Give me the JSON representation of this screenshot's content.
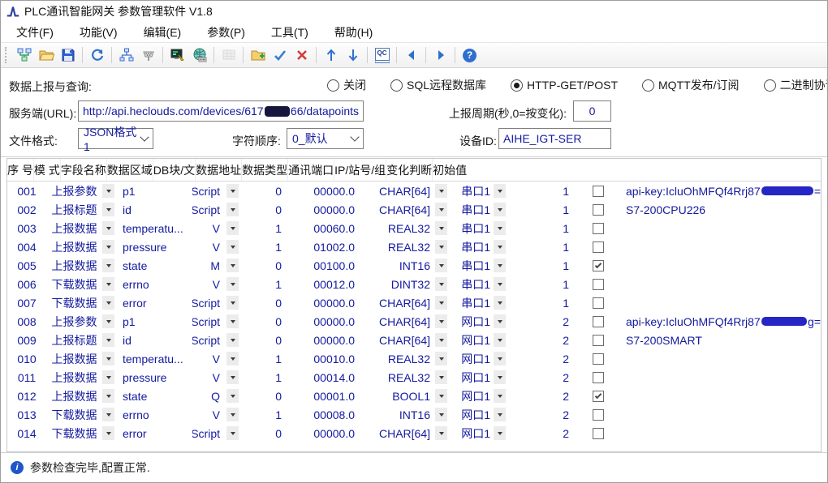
{
  "window": {
    "title": "PLC通讯智能网关 参数管理软件 V1.8"
  },
  "menubar": {
    "items": [
      {
        "name": "menu-file",
        "label": "文件(F)"
      },
      {
        "name": "menu-function",
        "label": "功能(V)"
      },
      {
        "name": "menu-edit",
        "label": "编辑(E)"
      },
      {
        "name": "menu-params",
        "label": "参数(P)"
      },
      {
        "name": "menu-tools",
        "label": "工具(T)"
      },
      {
        "name": "menu-help",
        "label": "帮助(H)"
      }
    ]
  },
  "toolbar": {
    "qc_label": "QC"
  },
  "icons": {
    "help_glyph": "?",
    "info_glyph": "i"
  },
  "colors": {
    "navy": "#131a9e"
  },
  "config": {
    "report_label": "数据上报与查询:",
    "report_options": [
      {
        "name": "radio-close",
        "label": "关闭",
        "selected": false
      },
      {
        "name": "radio-sql",
        "label": "SQL远程数据库",
        "selected": false
      },
      {
        "name": "radio-http",
        "label": "HTTP-GET/POST",
        "selected": true
      },
      {
        "name": "radio-mqtt",
        "label": "MQTT发布/订阅",
        "selected": false
      },
      {
        "name": "radio-binary",
        "label": "二进制协议收/发",
        "selected": false
      }
    ],
    "url_label": "服务端(URL):",
    "url": {
      "prefix": "http://api.heclouds.com/devices/617",
      "redact": true,
      "suffix": "66/datapoints"
    },
    "period_label": "上报周期(秒,0=按变化):",
    "period_value": "0",
    "format_label": "文件格式:",
    "format_value": "JSON格式1",
    "order_label": "字符顺序:",
    "order_value": "0_默认",
    "device_label": "设备ID:",
    "device_value": "AIHE_IGT-SER"
  },
  "table": {
    "columns": [
      {
        "label": "序 号"
      },
      {
        "label": "模 式"
      },
      {
        "label": "字段名称"
      },
      {
        "label": "数据区域"
      },
      {
        "label": "DB块/文"
      },
      {
        "label": "数据地址"
      },
      {
        "label": "数据类型"
      },
      {
        "label": "通讯端口"
      },
      {
        "label": "IP/站号/组"
      },
      {
        "label": "变化判断"
      },
      {
        "label": "初始值"
      }
    ],
    "rows": [
      {
        "idx": "001",
        "mode": "上报参数",
        "field": "p1",
        "area": "Script",
        "db": "0",
        "addr": "00000.0",
        "type": "CHAR[64]",
        "port": "串口1",
        "ip": "1",
        "changed": false,
        "init": {
          "prefix": "api-key:IcluOhMFQf4Rrj87",
          "redact": true,
          "suffix": "="
        }
      },
      {
        "idx": "002",
        "mode": "上报标题",
        "field": "id",
        "area": "Script",
        "db": "0",
        "addr": "00000.0",
        "type": "CHAR[64]",
        "port": "串口1",
        "ip": "1",
        "changed": false,
        "init": {
          "prefix": "S7-200CPU226"
        }
      },
      {
        "idx": "003",
        "mode": "上报数据",
        "field": "temperatu...",
        "area": "V",
        "db": "1",
        "addr": "00060.0",
        "type": "REAL32",
        "port": "串口1",
        "ip": "1",
        "changed": false
      },
      {
        "idx": "004",
        "mode": "上报数据",
        "field": "pressure",
        "area": "V",
        "db": "1",
        "addr": "01002.0",
        "type": "REAL32",
        "port": "串口1",
        "ip": "1",
        "changed": false
      },
      {
        "idx": "005",
        "mode": "上报数据",
        "field": "state",
        "area": "M",
        "db": "0",
        "addr": "00100.0",
        "type": "INT16",
        "port": "串口1",
        "ip": "1",
        "changed": true
      },
      {
        "idx": "006",
        "mode": "下载数据",
        "field": "errno",
        "area": "V",
        "db": "1",
        "addr": "00012.0",
        "type": "DINT32",
        "port": "串口1",
        "ip": "1",
        "changed": false
      },
      {
        "idx": "007",
        "mode": "下载数据",
        "field": "error",
        "area": "Script",
        "db": "0",
        "addr": "00000.0",
        "type": "CHAR[64]",
        "port": "串口1",
        "ip": "1",
        "changed": false
      },
      {
        "idx": "008",
        "mode": "上报参数",
        "field": "p1",
        "area": "Script",
        "db": "0",
        "addr": "00000.0",
        "type": "CHAR[64]",
        "port": "网口1",
        "ip": "2",
        "changed": false,
        "init": {
          "prefix": "api-key:IcluOhMFQf4Rrj87",
          "redact": true,
          "suffix": "g="
        }
      },
      {
        "idx": "009",
        "mode": "上报标题",
        "field": "id",
        "area": "Script",
        "db": "0",
        "addr": "00000.0",
        "type": "CHAR[64]",
        "port": "网口1",
        "ip": "2",
        "changed": false,
        "init": {
          "prefix": "S7-200SMART"
        }
      },
      {
        "idx": "010",
        "mode": "上报数据",
        "field": "temperatu...",
        "area": "V",
        "db": "1",
        "addr": "00010.0",
        "type": "REAL32",
        "port": "网口1",
        "ip": "2",
        "changed": false
      },
      {
        "idx": "011",
        "mode": "上报数据",
        "field": "pressure",
        "area": "V",
        "db": "1",
        "addr": "00014.0",
        "type": "REAL32",
        "port": "网口1",
        "ip": "2",
        "changed": false
      },
      {
        "idx": "012",
        "mode": "上报数据",
        "field": "state",
        "area": "Q",
        "db": "0",
        "addr": "00001.0",
        "type": "BOOL1",
        "port": "网口1",
        "ip": "2",
        "changed": true
      },
      {
        "idx": "013",
        "mode": "下载数据",
        "field": "errno",
        "area": "V",
        "db": "1",
        "addr": "00008.0",
        "type": "INT16",
        "port": "网口1",
        "ip": "2",
        "changed": false
      },
      {
        "idx": "014",
        "mode": "下载数据",
        "field": "error",
        "area": "Script",
        "db": "0",
        "addr": "00000.0",
        "type": "CHAR[64]",
        "port": "网口1",
        "ip": "2",
        "changed": false
      }
    ]
  },
  "statusbar": {
    "text": "参数检查完毕,配置正常."
  }
}
